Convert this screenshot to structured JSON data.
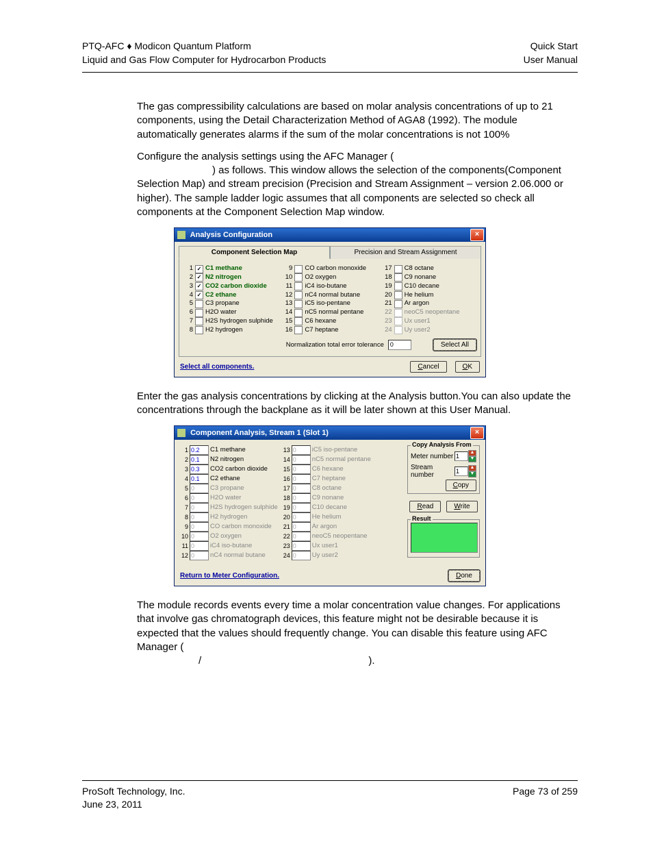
{
  "header": {
    "left1": "PTQ-AFC ♦ Modicon Quantum Platform",
    "left2": "Liquid and Gas Flow Computer for Hydrocarbon Products",
    "right1": "Quick Start",
    "right2": "User Manual"
  },
  "para1": "The gas compressibility calculations are based on molar analysis concentrations of up to 21 components, using the Detail Characterization Method of AGA8 (1992). The module automatically generates alarms if the sum of the molar concentrations is not 100%",
  "para2a": "Configure the analysis settings using the AFC Manager (",
  "para2b": ") as follows. This window allows the selection of the components(Component Selection Map) and stream precision (Precision and Stream Assignment – version 2.06.000 or higher). The sample ladder logic assumes that all components are selected so check all components at the Component Selection Map window.",
  "dialog1": {
    "title": "Analysis Configuration",
    "tab_active": "Component Selection Map",
    "tab_inactive": "Precision and Stream Assignment",
    "components": [
      {
        "n": 1,
        "label": "C1 methane",
        "checked": true,
        "bold": true,
        "dim": false
      },
      {
        "n": 2,
        "label": "N2 nitrogen",
        "checked": true,
        "bold": true,
        "dim": false
      },
      {
        "n": 3,
        "label": "CO2 carbon dioxide",
        "checked": true,
        "bold": true,
        "dim": false
      },
      {
        "n": 4,
        "label": "C2 ethane",
        "checked": true,
        "bold": true,
        "dim": false
      },
      {
        "n": 5,
        "label": "C3 propane",
        "checked": false,
        "bold": false,
        "dim": false
      },
      {
        "n": 6,
        "label": "H2O water",
        "checked": false,
        "bold": false,
        "dim": false
      },
      {
        "n": 7,
        "label": "H2S hydrogen sulphide",
        "checked": false,
        "bold": false,
        "dim": false
      },
      {
        "n": 8,
        "label": "H2 hydrogen",
        "checked": false,
        "bold": false,
        "dim": false
      },
      {
        "n": 9,
        "label": "CO carbon monoxide",
        "checked": false,
        "bold": false,
        "dim": false
      },
      {
        "n": 10,
        "label": "O2 oxygen",
        "checked": false,
        "bold": false,
        "dim": false
      },
      {
        "n": 11,
        "label": "iC4 iso-butane",
        "checked": false,
        "bold": false,
        "dim": false
      },
      {
        "n": 12,
        "label": "nC4 normal butane",
        "checked": false,
        "bold": false,
        "dim": false
      },
      {
        "n": 13,
        "label": "iC5 iso-pentane",
        "checked": false,
        "bold": false,
        "dim": false
      },
      {
        "n": 14,
        "label": "nC5 normal pentane",
        "checked": false,
        "bold": false,
        "dim": false
      },
      {
        "n": 15,
        "label": "C6 hexane",
        "checked": false,
        "bold": false,
        "dim": false
      },
      {
        "n": 16,
        "label": "C7 heptane",
        "checked": false,
        "bold": false,
        "dim": false
      },
      {
        "n": 17,
        "label": "C8 octane",
        "checked": false,
        "bold": false,
        "dim": false
      },
      {
        "n": 18,
        "label": "C9 nonane",
        "checked": false,
        "bold": false,
        "dim": false
      },
      {
        "n": 19,
        "label": "C10 decane",
        "checked": false,
        "bold": false,
        "dim": false
      },
      {
        "n": 20,
        "label": "He helium",
        "checked": false,
        "bold": false,
        "dim": false
      },
      {
        "n": 21,
        "label": "Ar argon",
        "checked": false,
        "bold": false,
        "dim": false
      },
      {
        "n": 22,
        "label": "neoC5 neopentane",
        "checked": false,
        "bold": false,
        "dim": true
      },
      {
        "n": 23,
        "label": "Ux user1",
        "checked": false,
        "bold": false,
        "dim": true
      },
      {
        "n": 24,
        "label": "Uy user2",
        "checked": false,
        "bold": false,
        "dim": true
      }
    ],
    "norm_label": "Normalization total error tolerance",
    "norm_value": "0",
    "select_all": "Select All",
    "status": "Select all components.",
    "cancel": "Cancel",
    "ok": "OK"
  },
  "para3": "Enter the gas analysis concentrations by clicking at the Analysis button.You can also update the concentrations through the backplane as it will be later shown at this User Manual.",
  "dialog2": {
    "title": "Component Analysis, Stream 1 (Slot 1)",
    "rows": [
      {
        "n": 1,
        "val": "0.2",
        "label": "C1 methane",
        "dim": false
      },
      {
        "n": 2,
        "val": "0.1",
        "label": "N2 nitrogen",
        "dim": false
      },
      {
        "n": 3,
        "val": "0.3",
        "label": "CO2 carbon dioxide",
        "dim": false
      },
      {
        "n": 4,
        "val": "0.1",
        "label": "C2 ethane",
        "dim": false
      },
      {
        "n": 5,
        "val": "0",
        "label": "C3 propane",
        "dim": true
      },
      {
        "n": 6,
        "val": "0",
        "label": "H2O water",
        "dim": true
      },
      {
        "n": 7,
        "val": "0",
        "label": "H2S hydrogen sulphide",
        "dim": true
      },
      {
        "n": 8,
        "val": "0",
        "label": "H2 hydrogen",
        "dim": true
      },
      {
        "n": 9,
        "val": "0",
        "label": "CO carbon monoxide",
        "dim": true
      },
      {
        "n": 10,
        "val": "0",
        "label": "O2 oxygen",
        "dim": true
      },
      {
        "n": 11,
        "val": "0",
        "label": "iC4 iso-butane",
        "dim": true
      },
      {
        "n": 12,
        "val": "0",
        "label": "nC4 normal butane",
        "dim": true
      },
      {
        "n": 13,
        "val": "0",
        "label": "iC5 iso-pentane",
        "dim": true
      },
      {
        "n": 14,
        "val": "0",
        "label": "nC5 normal pentane",
        "dim": true
      },
      {
        "n": 15,
        "val": "0",
        "label": "C6 hexane",
        "dim": true
      },
      {
        "n": 16,
        "val": "0",
        "label": "C7 heptane",
        "dim": true
      },
      {
        "n": 17,
        "val": "0",
        "label": "C8 octane",
        "dim": true
      },
      {
        "n": 18,
        "val": "0",
        "label": "C9 nonane",
        "dim": true
      },
      {
        "n": 19,
        "val": "0",
        "label": "C10 decane",
        "dim": true
      },
      {
        "n": 20,
        "val": "0",
        "label": "He helium",
        "dim": true
      },
      {
        "n": 21,
        "val": "0",
        "label": "Ar argon",
        "dim": true
      },
      {
        "n": 22,
        "val": "0",
        "label": "neoC5 neopentane",
        "dim": true
      },
      {
        "n": 23,
        "val": "0",
        "label": "Ux user1",
        "dim": true
      },
      {
        "n": 24,
        "val": "0",
        "label": "Uy user2",
        "dim": true
      }
    ],
    "copy_legend": "Copy Analysis From",
    "meter_label": "Meter number",
    "meter_value": "1",
    "stream_label": "Stream number",
    "stream_value": "1",
    "copy_btn": "Copy",
    "read_btn": "Read",
    "write_btn": "Write",
    "result_legend": "Result",
    "status": "Return to Meter Configuration.",
    "done_btn": "Done"
  },
  "para4a": "The module records events every time a molar concentration value changes. For applications that involve gas chromatograph devices, this feature might not be desirable because it is expected that the values should frequently change. You can disable this feature using AFC Manager (",
  "para4b": " / ",
  "para4c": ").",
  "footer": {
    "left1": "ProSoft Technology, Inc.",
    "left2": "June 23, 2011",
    "right": "Page 73 of 259"
  }
}
